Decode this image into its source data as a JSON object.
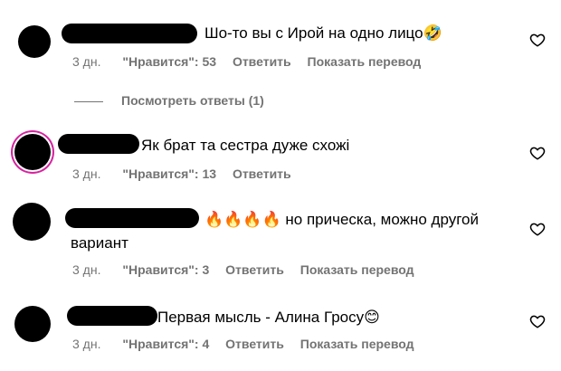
{
  "comments": [
    {
      "text": "Шо-то вы с Ирой на одно лицо🤣",
      "time": "3 дн.",
      "likes": "\"Нравится\": 53",
      "reply": "Ответить",
      "translate": "Показать перевод"
    },
    {
      "text": "Як брат та сестра дуже схожі",
      "time": "3 дн.",
      "likes": "\"Нравится\": 13",
      "reply": "Ответить"
    },
    {
      "text_line1": "🔥🔥🔥🔥 но прическа, можно другой",
      "text_line2": "вариант",
      "time": "3 дн.",
      "likes": "\"Нравится\": 3",
      "reply": "Ответить",
      "translate": "Показать перевод"
    },
    {
      "text": "Первая мысль - Алина Гросу😊",
      "time": "3 дн.",
      "likes": "\"Нравится\": 4",
      "reply": "Ответить",
      "translate": "Показать перевод"
    }
  ],
  "view_replies": "Посмотреть ответы (1)",
  "colors": {
    "meta": "#737373",
    "story_ring": "#d6249f"
  },
  "icons": {
    "like": "heart-outline-icon"
  }
}
